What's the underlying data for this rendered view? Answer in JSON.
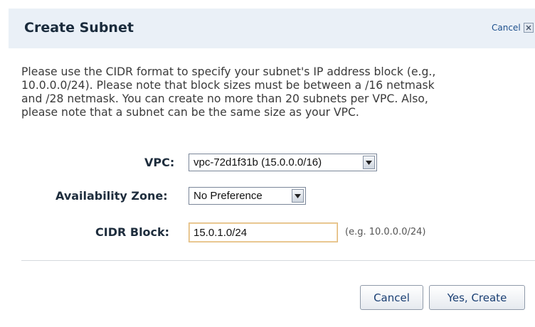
{
  "dialog": {
    "title": "Create Subnet",
    "cancel_link": "Cancel",
    "instructions": [
      "Please use the CIDR format to specify your subnet's IP address block (e.g.,",
      "10.0.0.0/24). Please note that block sizes must be between a /16 netmask",
      "and /28 netmask. You can create no more than 20 subnets per VPC. Also,",
      "please note that a subnet can be the same size as your VPC."
    ]
  },
  "form": {
    "vpc": {
      "label": "VPC:",
      "selected": "vpc-72d1f31b (15.0.0.0/16)"
    },
    "availability_zone": {
      "label": "Availability Zone:",
      "selected": "No Preference"
    },
    "cidr_block": {
      "label": "CIDR Block:",
      "value": "15.0.1.0/24",
      "hint": "(e.g. 10.0.0.0/24)"
    }
  },
  "footer": {
    "cancel_label": "Cancel",
    "create_label": "Yes, Create"
  },
  "colors": {
    "header_bg": "#eaf0f7",
    "link": "#1d4f8c",
    "input_focus_border": "#e0b87a"
  },
  "icons": {
    "close": "close-icon",
    "dropdown": "chevron-down-icon"
  }
}
